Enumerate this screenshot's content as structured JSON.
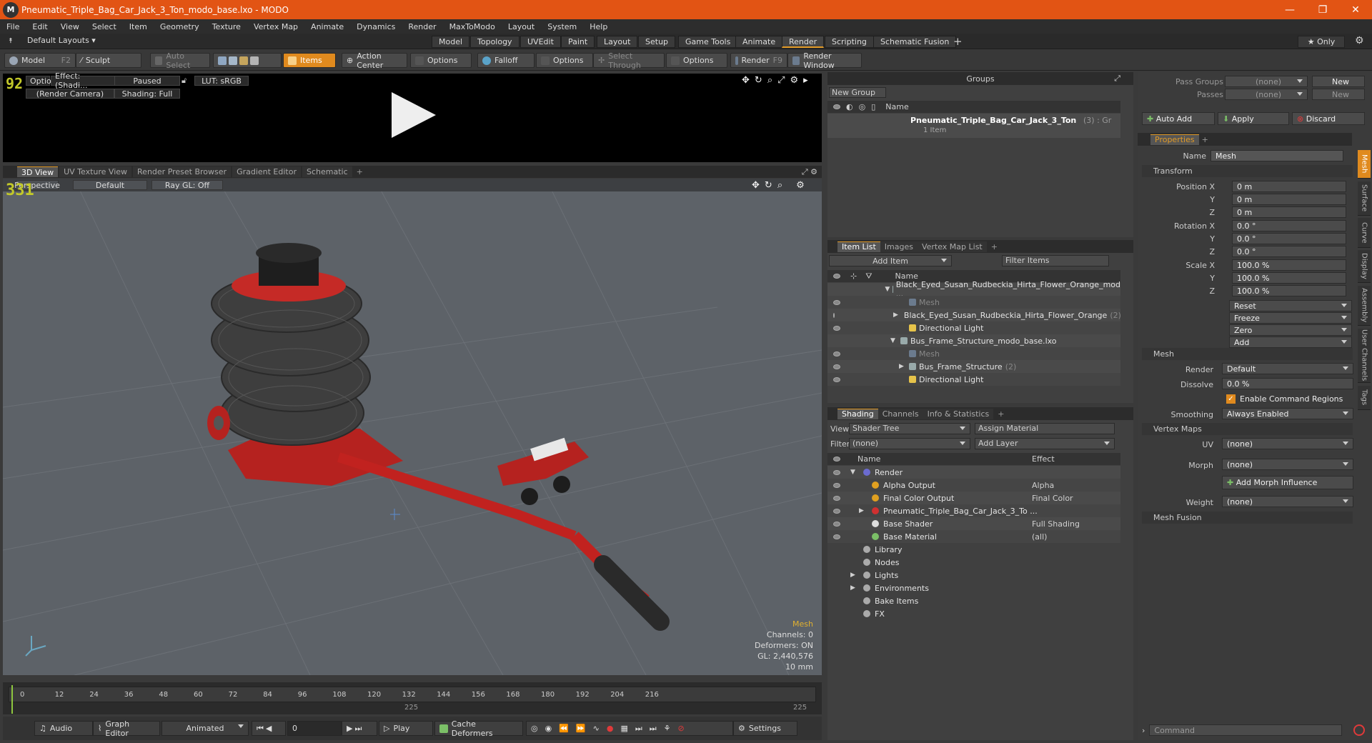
{
  "window": {
    "title": "Pneumatic_Triple_Bag_Car_Jack_3_Ton_modo_base.lxo - MODO",
    "logo": "M",
    "min": "—",
    "max": "❐",
    "close": "✕"
  },
  "menu": [
    "File",
    "Edit",
    "View",
    "Select",
    "Item",
    "Geometry",
    "Texture",
    "Vertex Map",
    "Animate",
    "Dynamics",
    "Render",
    "MaxToModo",
    "Layout",
    "System",
    "Help"
  ],
  "layouts": {
    "label": "Default Layouts ▾",
    "tabs": [
      "Model",
      "Topology",
      "UVEdit",
      "Paint",
      "Layout",
      "Setup",
      "Game Tools",
      "Animate",
      "Render",
      "Scripting",
      "Schematic Fusion"
    ],
    "active": "Render",
    "add": "+",
    "only": "★  Only"
  },
  "toolbar": {
    "model": "Model",
    "model_key": "F2",
    "sculpt": "Sculpt",
    "auto_select": "Auto Select",
    "items": "Items",
    "action_center": "Action Center",
    "options1": "Options",
    "falloff": "Falloff",
    "options2": "Options",
    "select_through": "Select Through",
    "options3": "Options",
    "render": "Render",
    "render_key": "F9",
    "render_window": "Render Window"
  },
  "preview": {
    "options": "Options",
    "effect": "Effect: (Shadi...",
    "paused": "Paused",
    "lut": "LUT: sRGB",
    "camera": "(Render Camera)",
    "shading": "Shading: Full",
    "fps": "92"
  },
  "viewtabs": [
    "3D View",
    "UV Texture View",
    "Render Preset Browser",
    "Gradient Editor",
    "Schematic"
  ],
  "viewport": {
    "perspective": "Perspective",
    "default": "Default",
    "raygl": "Ray GL: Off",
    "fps": "331",
    "stats": [
      "Mesh",
      "Channels: 0",
      "Deformers: ON",
      "GL: 2,440,576",
      "10 mm"
    ]
  },
  "timeline": {
    "ticks": [
      "0",
      "12",
      "24",
      "36",
      "48",
      "60",
      "72",
      "84",
      "96",
      "108",
      "120",
      "132",
      "144",
      "156",
      "168",
      "180",
      "192",
      "204",
      "216"
    ],
    "sub_a": "225",
    "sub_b": "225"
  },
  "bottom": {
    "audio": "Audio",
    "graph_editor": "Graph Editor",
    "animated": "Animated",
    "frame": "0",
    "play": "Play",
    "cache": "Cache Deformers",
    "settings": "Settings"
  },
  "groups": {
    "title": "Groups",
    "new_group": "New Group",
    "col_name": "Name",
    "item": "Pneumatic_Triple_Bag_Car_Jack_3_Ton",
    "item_suffix": "(3) : Gr",
    "item_sub": "1 Item"
  },
  "itemlist": {
    "tabs": [
      "Item List",
      "Images",
      "Vertex Map List"
    ],
    "add_item": "Add Item",
    "filter": "Filter Items",
    "col_name": "Name",
    "rows": [
      {
        "indent": 0,
        "arrow": "▼",
        "label": "Black_Eyed_Susan_Rudbeckia_Hirta_Flower_Orange_mod ...",
        "dim": false
      },
      {
        "indent": 1,
        "arrow": "",
        "label": "Mesh",
        "dim": true
      },
      {
        "indent": 1,
        "arrow": "▶",
        "label": "Black_Eyed_Susan_Rudbeckia_Hirta_Flower_Orange",
        "suffix": "(2)",
        "dim": false
      },
      {
        "indent": 1,
        "arrow": "",
        "label": "Directional Light",
        "dim": false
      },
      {
        "indent": 0,
        "arrow": "▼",
        "label": "Bus_Frame_Structure_modo_base.lxo",
        "dim": false
      },
      {
        "indent": 1,
        "arrow": "",
        "label": "Mesh",
        "dim": true
      },
      {
        "indent": 1,
        "arrow": "▶",
        "label": "Bus_Frame_Structure",
        "suffix": "(2)",
        "dim": false
      },
      {
        "indent": 1,
        "arrow": "",
        "label": "Directional Light",
        "dim": false
      }
    ]
  },
  "shading": {
    "tabs": [
      "Shading",
      "Channels",
      "Info & Statistics"
    ],
    "view_label": "View",
    "view_val": "Shader Tree",
    "assign": "Assign Material",
    "filter_label": "Filter",
    "filter_val": "(none)",
    "add_layer": "Add Layer",
    "col_name": "Name",
    "col_effect": "Effect",
    "rows": [
      {
        "indent": 0,
        "arrow": "▼",
        "label": "Render",
        "effect": ""
      },
      {
        "indent": 1,
        "arrow": "",
        "label": "Alpha Output",
        "effect": "Alpha"
      },
      {
        "indent": 1,
        "arrow": "",
        "label": "Final Color Output",
        "effect": "Final Color"
      },
      {
        "indent": 1,
        "arrow": "▶",
        "label": "Pneumatic_Triple_Bag_Car_Jack_3_To ...",
        "effect": ""
      },
      {
        "indent": 1,
        "arrow": "",
        "label": "Base Shader",
        "effect": "Full Shading"
      },
      {
        "indent": 1,
        "arrow": "",
        "label": "Base Material",
        "effect": "(all)"
      },
      {
        "indent": 0,
        "arrow": "",
        "label": "Library",
        "effect": ""
      },
      {
        "indent": 0,
        "arrow": "",
        "label": "Nodes",
        "effect": ""
      },
      {
        "indent": 0,
        "arrow": "▶",
        "label": "Lights",
        "effect": ""
      },
      {
        "indent": 0,
        "arrow": "▶",
        "label": "Environments",
        "effect": ""
      },
      {
        "indent": 0,
        "arrow": "",
        "label": "Bake Items",
        "effect": ""
      },
      {
        "indent": 0,
        "arrow": "",
        "label": "FX",
        "effect": ""
      }
    ]
  },
  "props": {
    "pass_groups": "Pass Groups",
    "passes": "Passes",
    "none": "(none)",
    "new": "New",
    "auto_add": "Auto Add",
    "apply": "Apply",
    "discard": "Discard",
    "tab": "Properties",
    "name_label": "Name",
    "name_val": "Mesh",
    "transform": "Transform",
    "pos_x": "Position X",
    "y": "Y",
    "z": "Z",
    "zero_m": "0 m",
    "rot_x": "Rotation X",
    "zero_deg": "0.0 °",
    "scale_x": "Scale X",
    "hundred": "100.0 %",
    "reset": "Reset",
    "freeze": "Freeze",
    "zero": "Zero",
    "add": "Add",
    "mesh": "Mesh",
    "render_label": "Render",
    "render_val": "Default",
    "dissolve_label": "Dissolve",
    "dissolve_val": "0.0 %",
    "enable_cmd": "Enable Command Regions",
    "smoothing_label": "Smoothing",
    "smoothing_val": "Always Enabled",
    "vertex_maps": "Vertex Maps",
    "uv_label": "UV",
    "morph_label": "Morph",
    "add_morph": "Add Morph Influence",
    "weight_label": "Weight",
    "mesh_fusion": "Mesh Fusion",
    "command": "Command",
    "sidetabs": [
      "Mesh",
      "Surface",
      "Curve",
      "Display",
      "Assembly",
      "User Channels",
      "Tags"
    ]
  }
}
